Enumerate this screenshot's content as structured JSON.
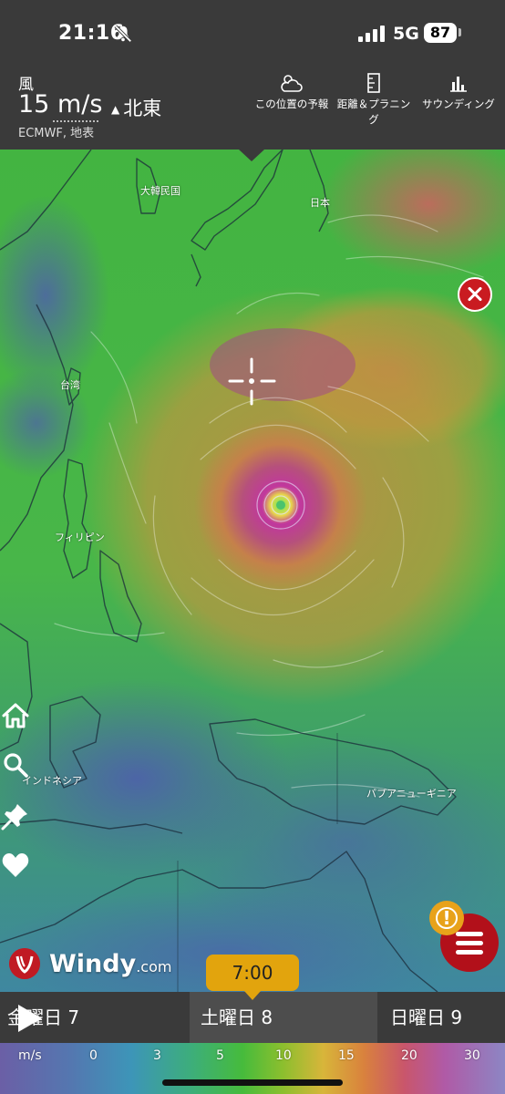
{
  "status_bar": {
    "time": "21:16",
    "network": "5G",
    "battery": "87",
    "icons": [
      "mute-bell-icon",
      "signal-bars-icon"
    ]
  },
  "header": {
    "label": "風",
    "wind_value": "15 m/s",
    "direction": "北東",
    "source": "ECMWF, 地表",
    "actions": [
      {
        "label": "この位置の予報",
        "icon": "weather-cloud-icon"
      },
      {
        "label": "距離＆プラニング",
        "icon": "ruler-icon"
      },
      {
        "label": "サウンディング",
        "icon": "sounding-chart-icon"
      }
    ]
  },
  "map": {
    "labels": {
      "korea": "大韓民国",
      "japan": "日本",
      "taiwan": "台湾",
      "philippines": "フィリピン",
      "indonesia": "インドネシア",
      "png": "パプアニューギニア"
    },
    "side_buttons": [
      "home-icon",
      "search-icon",
      "pin-icon",
      "heart-icon"
    ],
    "alert_badge": "!",
    "logo": {
      "name": "Windy",
      "suffix": ".com"
    }
  },
  "timeline": {
    "time": "7:00",
    "days": [
      "金曜日 7",
      "土曜日 8",
      "日曜日 9"
    ],
    "selected_day_index": 1
  },
  "legend": {
    "unit": "m/s",
    "ticks": [
      "0",
      "3",
      "5",
      "10",
      "15",
      "20",
      "30"
    ],
    "colors": [
      "#6b5fa6",
      "#3d95b8",
      "#46bb3c",
      "#d8b53a",
      "#d9823d",
      "#c9566b",
      "#b05aa6"
    ]
  },
  "colors": {
    "accent_red": "#c91b21",
    "timeline_orange": "#e2a40d",
    "panel_bg": "#3a3a3a"
  }
}
